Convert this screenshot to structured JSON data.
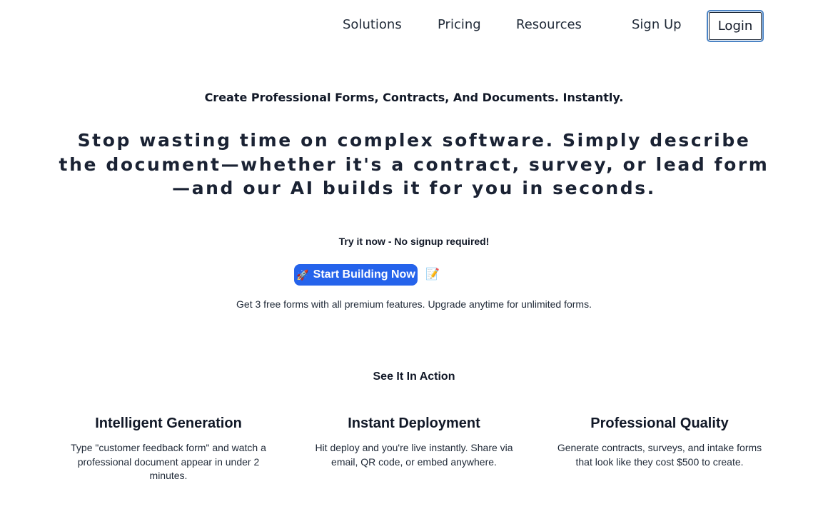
{
  "nav": {
    "solutions": "Solutions",
    "pricing": "Pricing",
    "resources": "Resources",
    "signup": "Sign Up",
    "login": "Login"
  },
  "hero": {
    "eyebrow": "Create Professional Forms, Contracts, And Documents. Instantly.",
    "headline": "Stop wasting time on complex software. Simply describe the document—whether it's a contract, survey, or lead form—and our AI builds it for you in seconds.",
    "try_label": "Try it now - No signup required!",
    "cta_icon": "🚀",
    "cta_label": "Start Building Now",
    "memo_icon": "📝",
    "free_note": "Get 3 free forms with all premium features. Upgrade anytime for unlimited forms."
  },
  "features": {
    "section_title": "See It In Action",
    "items": [
      {
        "title": "Intelligent Generation",
        "text": "Type \"customer feedback form\" and watch a professional document appear in under 2 minutes."
      },
      {
        "title": "Instant Deployment",
        "text": "Hit deploy and you're live instantly. Share via email, QR code, or embed anywhere."
      },
      {
        "title": "Professional Quality",
        "text": "Generate contracts, surveys, and intake forms that look like they cost $500 to create."
      }
    ]
  },
  "colors": {
    "primary_button": "#2563eb",
    "login_border": "#4b83c4",
    "text_dark": "#111827"
  }
}
